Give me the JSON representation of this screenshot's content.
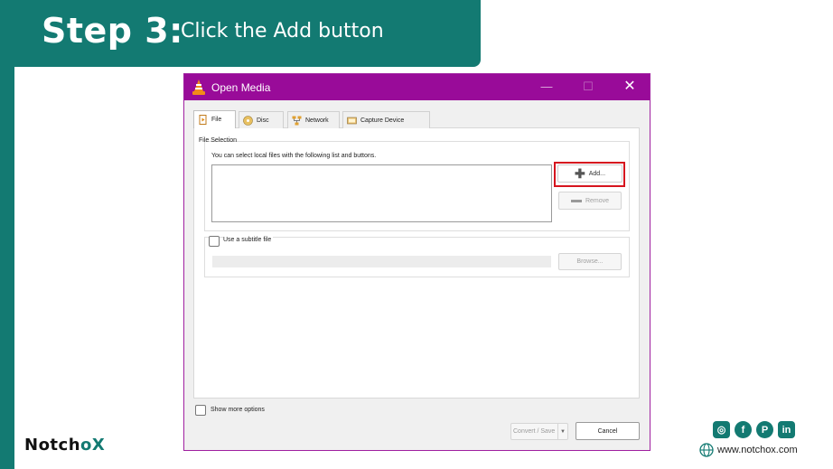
{
  "banner": {
    "step": "Step 3:",
    "instruction": "Click the Add button"
  },
  "window": {
    "title": "Open Media",
    "controls": {
      "minimize": "—",
      "maximize": "☐",
      "close": "✕"
    },
    "tabs": [
      {
        "label": "File",
        "icon": "file-icon",
        "active": true
      },
      {
        "label": "Disc",
        "icon": "disc-icon",
        "active": false
      },
      {
        "label": "Network",
        "icon": "network-icon",
        "active": false
      },
      {
        "label": "Capture Device",
        "icon": "capture-device-icon",
        "active": false
      }
    ],
    "file_selection": {
      "group_label": "File Selection",
      "description": "You can select local files with the following list and buttons.",
      "add_label": "Add...",
      "remove_label": "Remove"
    },
    "subtitle": {
      "label": "Use a subtitle file",
      "browse_label": "Browse..."
    },
    "show_more_label": "Show more options",
    "convert_label": "Convert / Save",
    "cancel_label": "Cancel"
  },
  "footer": {
    "logo_part1": "Notch",
    "logo_part2": "o",
    "logo_part3": "X",
    "website": "www.notchox.com",
    "socials": [
      "instagram-icon",
      "facebook-icon",
      "pinterest-icon",
      "linkedin-icon"
    ]
  },
  "colors": {
    "brand": "#137a72",
    "titlebar": "#990b99",
    "highlight": "#d6141e"
  }
}
